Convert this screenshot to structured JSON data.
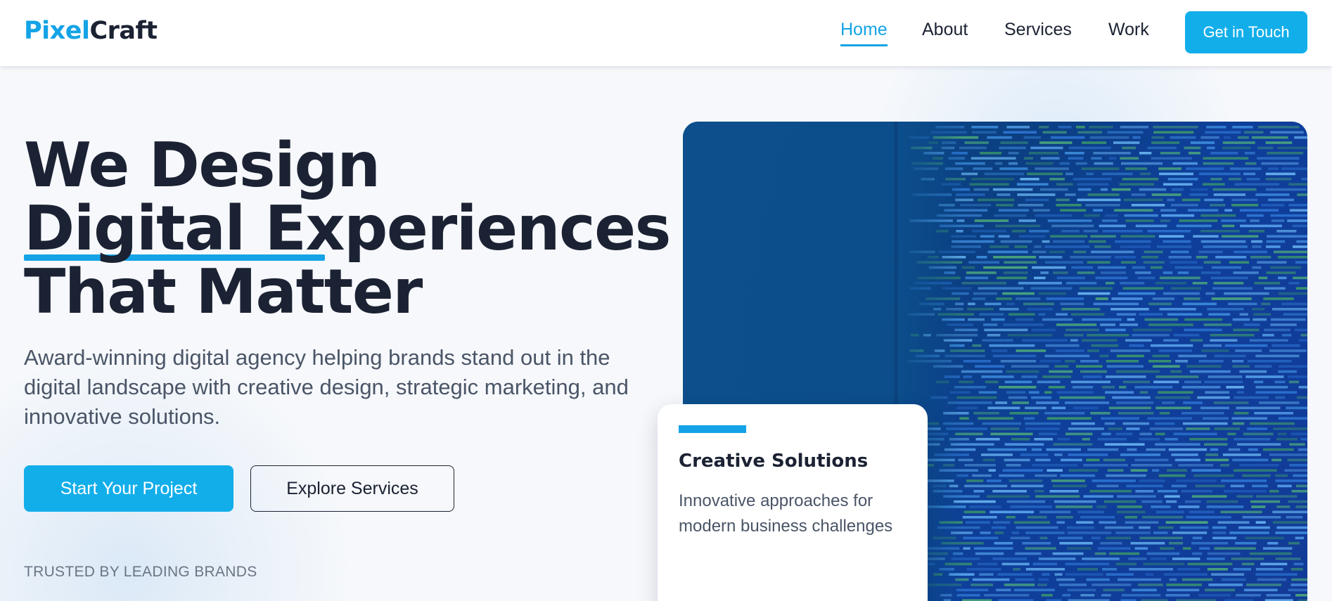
{
  "header": {
    "logo_part1": "Pixel",
    "logo_part2": "Craft",
    "nav": [
      "Home",
      "About",
      "Services",
      "Work"
    ],
    "active_nav": "Home",
    "cta_label": "Get in Touch"
  },
  "hero": {
    "headline_line1": "We Design",
    "headline_line2": "Digital Experiences",
    "headline_line3": "That Matter",
    "subtitle": "Award-winning digital agency helping brands stand out in the digital landscape with creative design, strategic marketing, and innovative solutions.",
    "primary_button": "Start Your Project",
    "secondary_button": "Explore Services",
    "trusted_label": "TRUSTED BY LEADING BRANDS"
  },
  "card": {
    "title": "Creative Solutions",
    "text": "Innovative approaches for modern business challenges"
  },
  "colors": {
    "accent": "#14a3e6",
    "button": "#12aeea",
    "text_dark": "#1b2233",
    "text_muted": "#4a5567"
  }
}
